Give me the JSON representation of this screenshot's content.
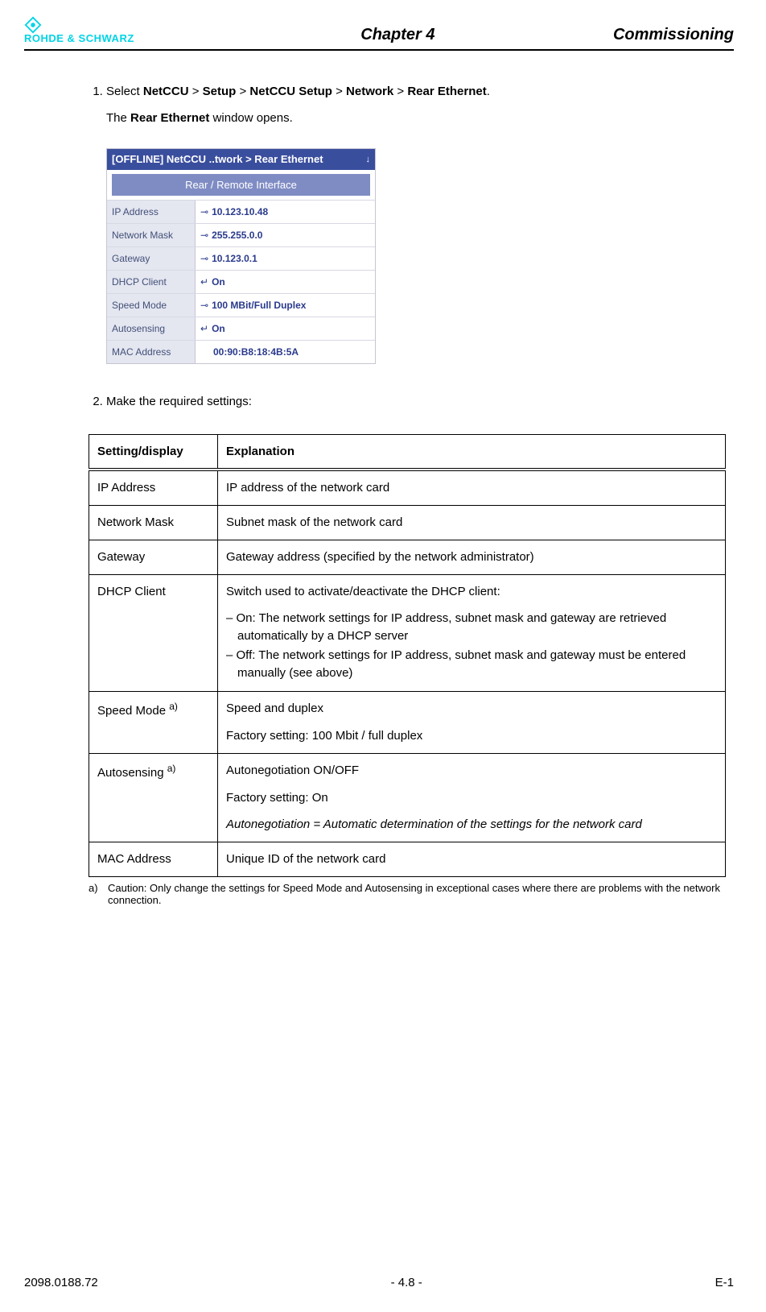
{
  "header": {
    "logo_text": "ROHDE & SCHWARZ",
    "chapter": "Chapter 4",
    "section": "Commissioning"
  },
  "steps": {
    "s1_pre": "Select ",
    "s1_p1": "NetCCU",
    "s1_gt": " > ",
    "s1_p2": "Setup",
    "s1_p3": "NetCCU Setup",
    "s1_p4": "Network",
    "s1_p5": "Rear Ethernet",
    "s1_end": ".",
    "s1_sub_pre": "The ",
    "s1_sub_b": "Rear Ethernet",
    "s1_sub_post": " window opens.",
    "s2": "Make the required settings:"
  },
  "ui": {
    "titlebar_left": "[OFFLINE] NetCCU ..twork > Rear Ethernet",
    "titlebar_arrow": "↓",
    "band": "Rear / Remote Interface",
    "rows": {
      "ip_label": "IP Address",
      "ip_val": "10.123.10.48",
      "mask_label": "Network Mask",
      "mask_val": "255.255.0.0",
      "gw_label": "Gateway",
      "gw_val": "10.123.0.1",
      "dhcp_label": "DHCP Client",
      "dhcp_val": "On",
      "speed_label": "Speed Mode",
      "speed_val": "100 MBit/Full Duplex",
      "auto_label": "Autosensing",
      "auto_val": "On",
      "mac_label": "MAC Address",
      "mac_val": "00:90:B8:18:4B:5A"
    },
    "link_glyph": "⊸",
    "enter_glyph": "↵"
  },
  "table": {
    "h1": "Setting/display",
    "h2": "Explanation",
    "r1c1": "IP Address",
    "r1c2": "IP address of the network card",
    "r2c1": "Network Mask",
    "r2c2": "Subnet mask of the network card",
    "r3c1": "Gateway",
    "r3c2": "Gateway address (specified by the network administrator)",
    "r4c1": "DHCP Client",
    "r4c2_p1": "Switch used to activate/deactivate the DHCP client:",
    "r4c2_li1": "On: The network settings for IP address, subnet mask and gateway are retrieved automatically by a DHCP server",
    "r4c2_li2": "Off: The network settings for IP address, subnet mask and gateway must be entered manually (see above)",
    "r5c1_pre": "Speed Mode ",
    "r5c1_sup": "a)",
    "r5c2_p1": "Speed and duplex",
    "r5c2_p2": "Factory setting: 100 Mbit / full duplex",
    "r6c1_pre": "Autosensing ",
    "r6c1_sup": "a)",
    "r6c2_p1": "Autonegotiation ON/OFF",
    "r6c2_p2": "Factory setting: On",
    "r6c2_p3": "Autonegotiation = Automatic determination of the settings for the network card",
    "r7c1": "MAC Address",
    "r7c2": "Unique ID of the network card"
  },
  "footnote": {
    "label": "a)",
    "text": "Caution: Only change the settings for Speed Mode and Autosensing in exceptional cases where there are problems with the network connection."
  },
  "footer": {
    "left": "2098.0188.72",
    "center": "- 4.8 -",
    "right": "E-1"
  }
}
